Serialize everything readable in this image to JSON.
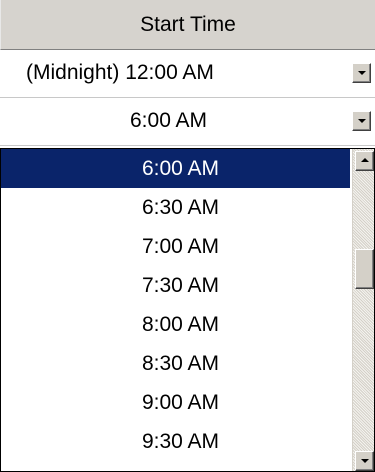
{
  "header": {
    "title": "Start Time"
  },
  "row1": {
    "value": "(Midnight) 12:00 AM"
  },
  "row2": {
    "value": "6:00 AM"
  },
  "dropdown": {
    "selected_index": 0,
    "items": [
      "6:00 AM",
      "6:30 AM",
      "7:00 AM",
      "7:30 AM",
      "8:00 AM",
      "8:30 AM",
      "9:00 AM",
      "9:30 AM"
    ]
  },
  "icons": {
    "dropdown_arrow": "chevron-down-icon",
    "scroll_up": "chevron-up-icon",
    "scroll_down": "chevron-down-icon"
  },
  "colors": {
    "header_bg": "#d6d3ce",
    "selection_bg": "#0a246a",
    "selection_text": "#ffffff"
  }
}
